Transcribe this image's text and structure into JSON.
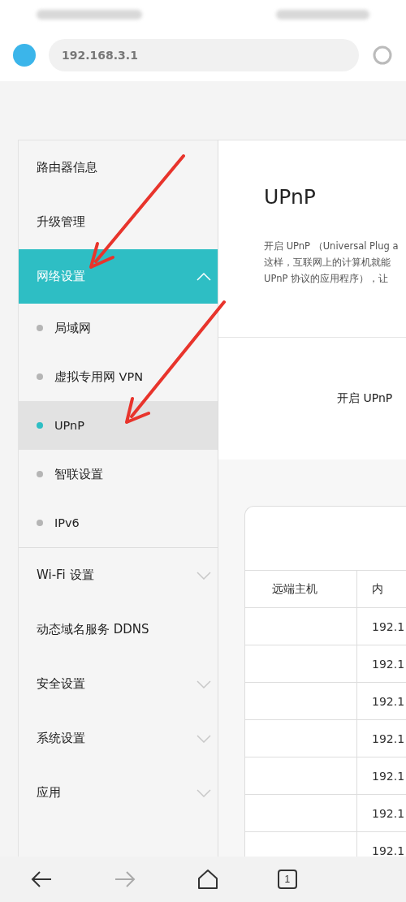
{
  "browser": {
    "url": "192.168.3.1"
  },
  "sidebar": {
    "items": [
      {
        "label": "路由器信息",
        "selected": false
      },
      {
        "label": "升级管理",
        "selected": false
      },
      {
        "label": "网络设置",
        "selected": true,
        "expanded": true,
        "children": [
          {
            "label": "局域网",
            "selected": false
          },
          {
            "label": "虚拟专用网 VPN",
            "selected": false
          },
          {
            "label": "UPnP",
            "selected": true
          },
          {
            "label": "智联设置",
            "selected": false
          },
          {
            "label": "IPv6",
            "selected": false
          }
        ]
      },
      {
        "label": "Wi-Fi 设置",
        "selected": false,
        "expanded": false
      },
      {
        "label": "动态域名服务 DDNS",
        "selected": false
      },
      {
        "label": "安全设置",
        "selected": false,
        "expanded": false
      },
      {
        "label": "系统设置",
        "selected": false,
        "expanded": false
      },
      {
        "label": "应用",
        "selected": false,
        "expanded": false
      }
    ]
  },
  "content": {
    "title": "UPnP",
    "description": [
      "开启 UPnP （Universal Plug a",
      "这样，互联网上的计算机就能",
      "UPnP 协议的应用程序），让"
    ],
    "toggle_label": "开启 UPnP",
    "table": {
      "columns": [
        "远端主机",
        "内"
      ],
      "rows": [
        [
          "",
          "192.1"
        ],
        [
          "",
          "192.1"
        ],
        [
          "",
          "192.1"
        ],
        [
          "",
          "192.1"
        ],
        [
          "",
          "192.1"
        ],
        [
          "",
          "192.1"
        ],
        [
          "",
          "192.1"
        ]
      ]
    }
  },
  "nav_bar": {
    "back": {
      "disabled": false
    },
    "forward": {
      "disabled": true
    },
    "tab_count": "1"
  }
}
